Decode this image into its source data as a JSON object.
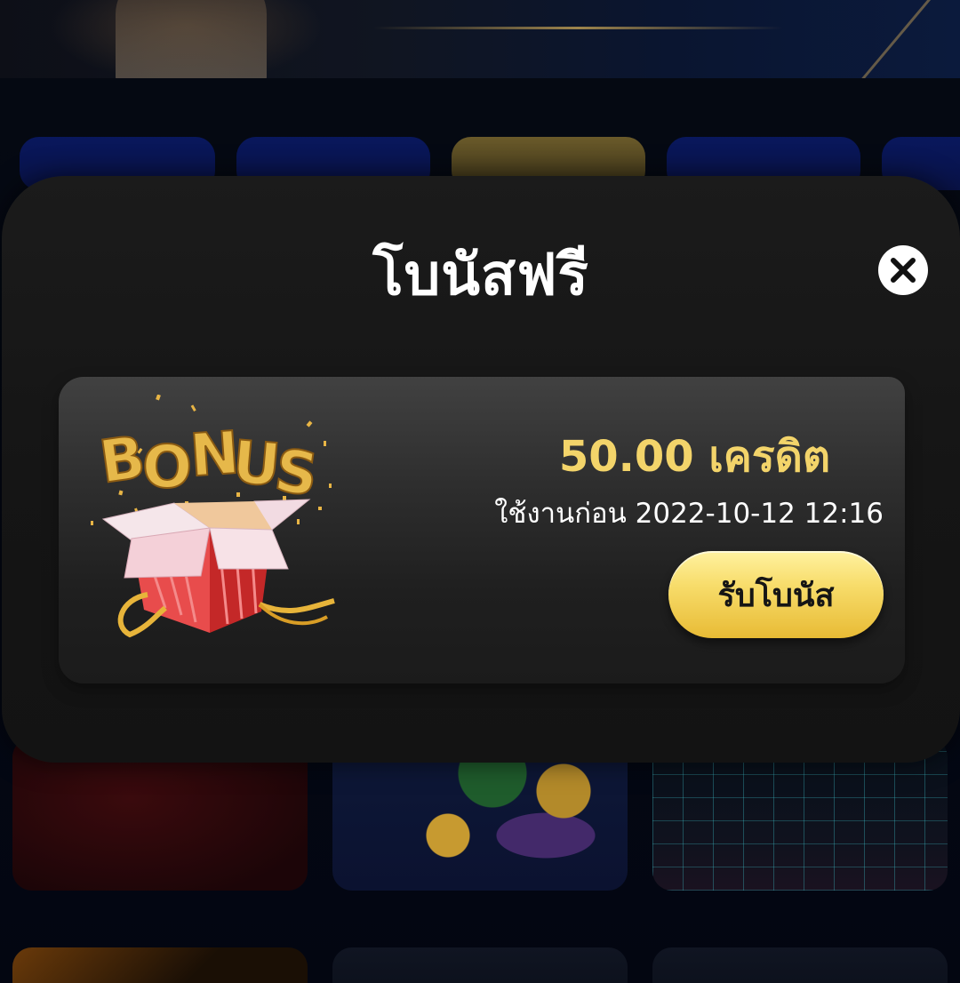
{
  "modal": {
    "title": "โบนัสฟรี",
    "close_icon": "close-icon"
  },
  "bonus": {
    "image_label": "BONUS",
    "amount": "50.00 เครดิต",
    "expiry": "ใช้งานก่อน 2022-10-12 12:16",
    "claim_label": "รับโบนัส"
  },
  "colors": {
    "modal_bg": "#151515",
    "card_bg": "#2e2e2e",
    "amount_gold": "#f3d46a",
    "button_gold": "#f7dc6a",
    "title_white": "#ffffff"
  }
}
